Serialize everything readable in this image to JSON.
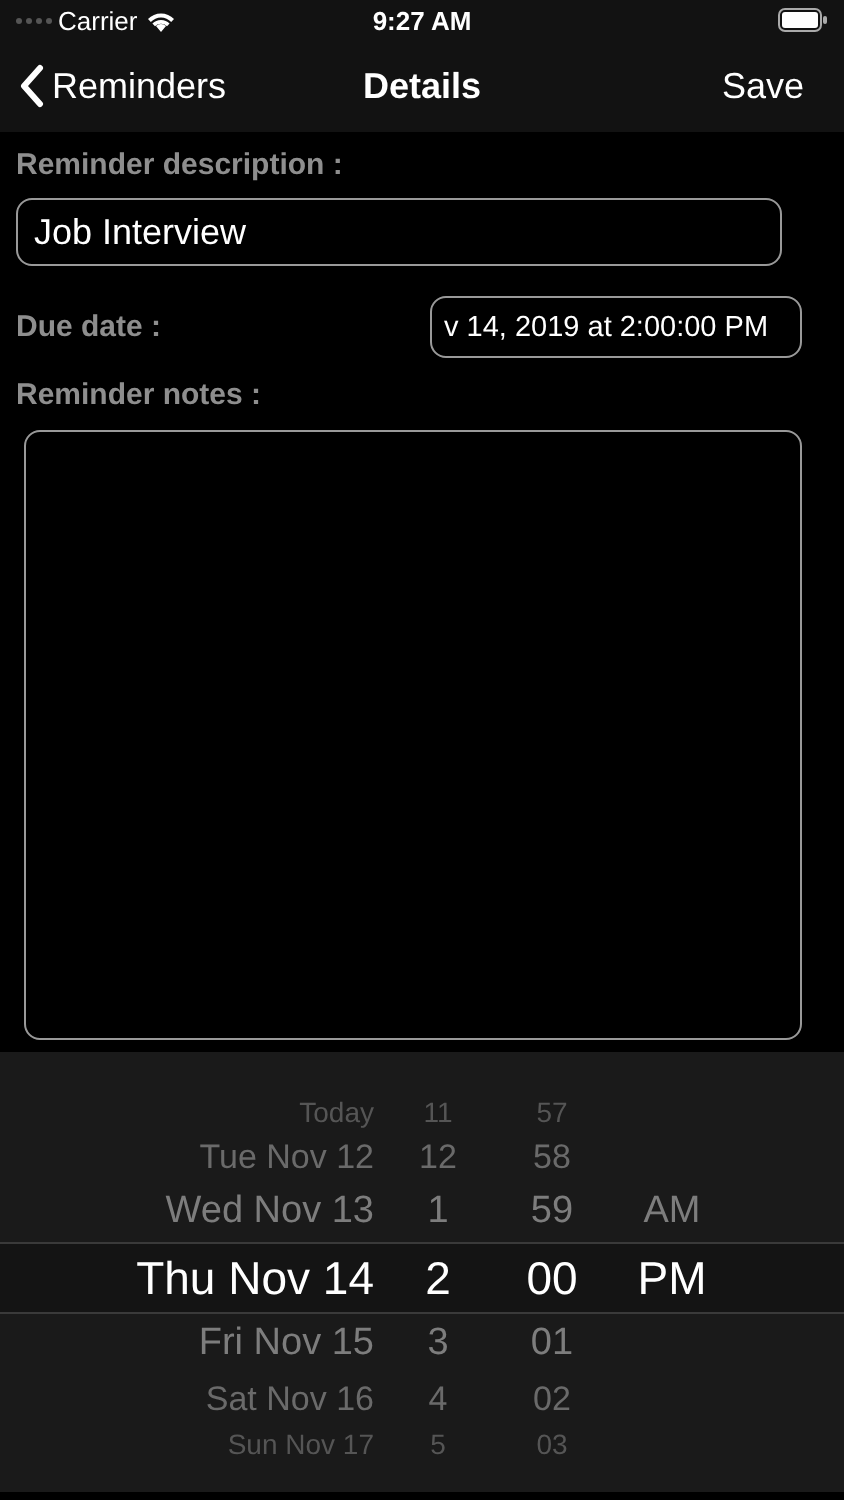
{
  "status_bar": {
    "carrier": "Carrier",
    "time": "9:27 AM"
  },
  "nav": {
    "back": "Reminders",
    "title": "Details",
    "action": "Save"
  },
  "form": {
    "description_label": "Reminder description :",
    "description_value": "Job Interview",
    "due_label": "Due date :",
    "due_value": "v 14, 2019 at 2:00:00 PM",
    "notes_label": "Reminder notes :"
  },
  "picker": {
    "rows": [
      {
        "date": "Today",
        "hour": "11",
        "minute": "57",
        "selected": false
      },
      {
        "date": "Tue Nov 12",
        "hour": "12",
        "minute": "58",
        "selected": false
      },
      {
        "date": "Wed Nov 13",
        "hour": "1",
        "minute": "59",
        "period": "AM",
        "selected": false
      },
      {
        "date": "Thu Nov 14",
        "hour": "2",
        "minute": "00",
        "period": "PM",
        "selected": true
      },
      {
        "date": "Fri Nov 15",
        "hour": "3",
        "minute": "01",
        "selected": false
      },
      {
        "date": "Sat Nov 16",
        "hour": "4",
        "minute": "02",
        "selected": false
      },
      {
        "date": "Sun Nov 17",
        "hour": "5",
        "minute": "03",
        "selected": false
      }
    ]
  }
}
